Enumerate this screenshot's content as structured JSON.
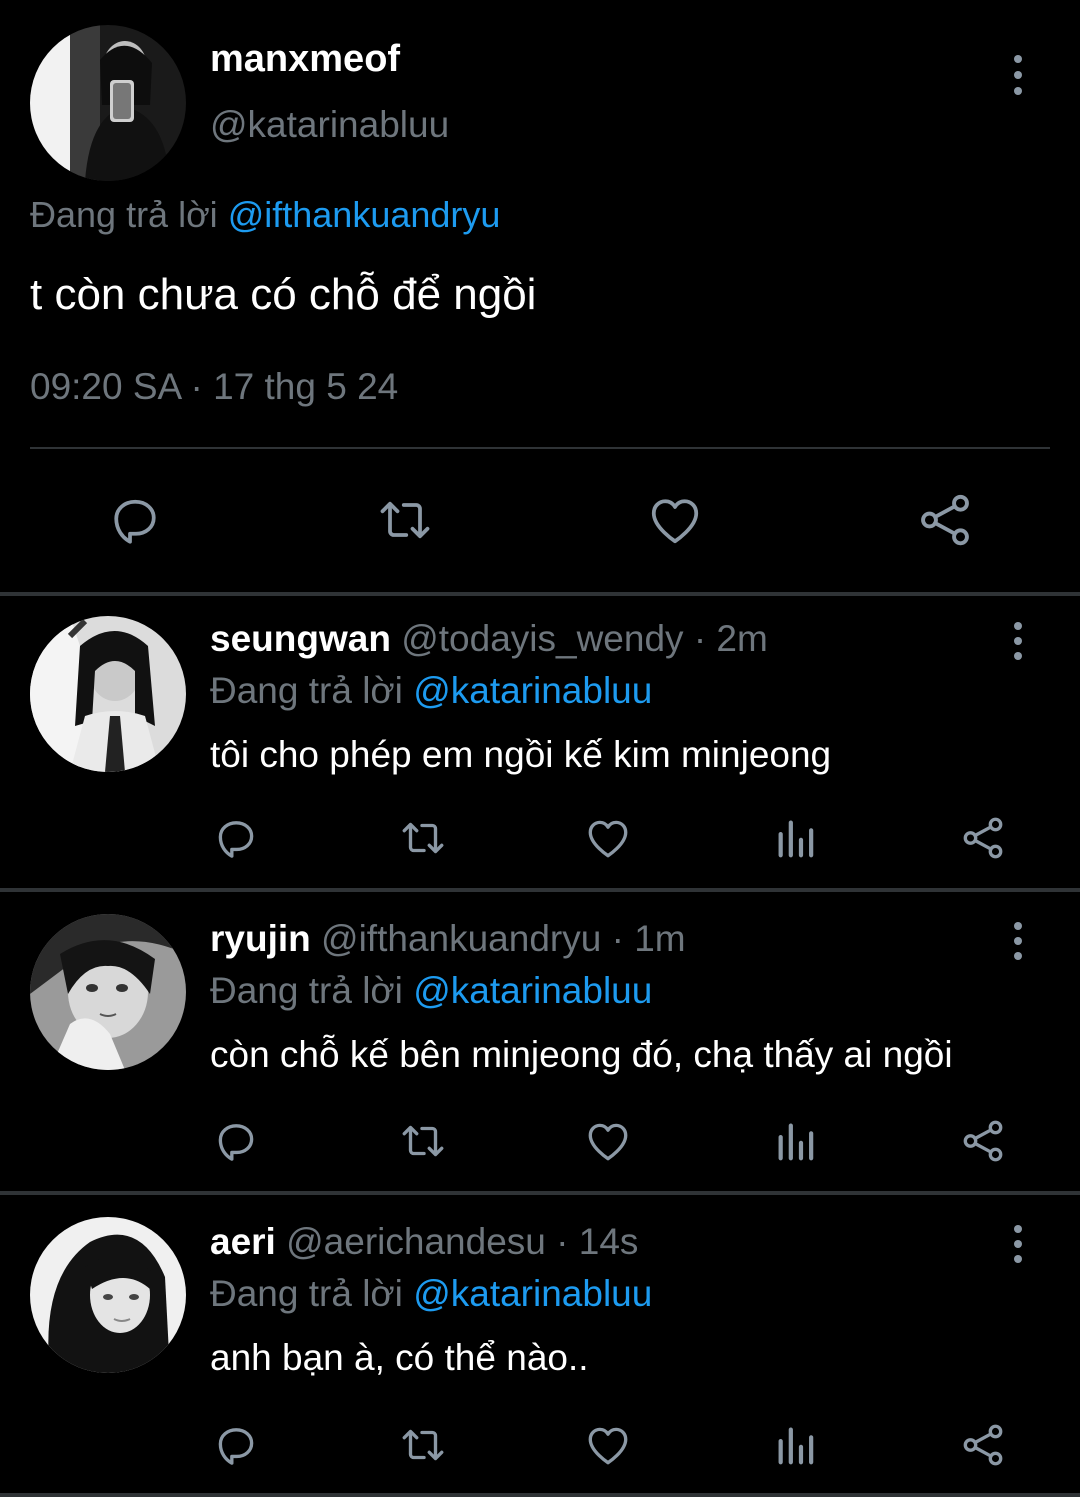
{
  "main_tweet": {
    "display_name": "manxmeof",
    "handle": "@katarinabluu",
    "replying_prefix": "Đang trả lời",
    "replying_to": "@ifthankuandryu",
    "text": "t còn chưa có chỗ để ngồi",
    "timestamp": "09:20 SA · 17 thg 5 24",
    "actions": [
      "reply-icon",
      "retweet-icon",
      "like-icon",
      "share-icon"
    ]
  },
  "replies": [
    {
      "display_name": "seungwan",
      "handle": "@todayis_wendy",
      "time": "· 2m",
      "replying_prefix": "Đang trả lời",
      "replying_to": "@katarinabluu",
      "text": "tôi cho phép em ngồi kế kim minjeong"
    },
    {
      "display_name": "ryujin",
      "handle": "@ifthankuandryu",
      "time": "· 1m",
      "replying_prefix": "Đang trả lời",
      "replying_to": "@katarinabluu",
      "text": "còn chỗ kế bên minjeong đó, chạ thấy ai ngồi"
    },
    {
      "display_name": "aeri",
      "handle": "@aerichandesu",
      "time": "· 14s",
      "replying_prefix": "Đang trả lời",
      "replying_to": "@katarinabluu",
      "text": "anh bạn à, có thể nào.."
    }
  ],
  "reply_actions": [
    "reply-icon",
    "retweet-icon",
    "like-icon",
    "views-icon",
    "share-icon"
  ],
  "colors": {
    "background": "#000000",
    "text": "#e7e9ea",
    "muted": "#6e767d",
    "link": "#1d9bf0",
    "divider": "#2f3336",
    "icon": "#8b98a5"
  }
}
